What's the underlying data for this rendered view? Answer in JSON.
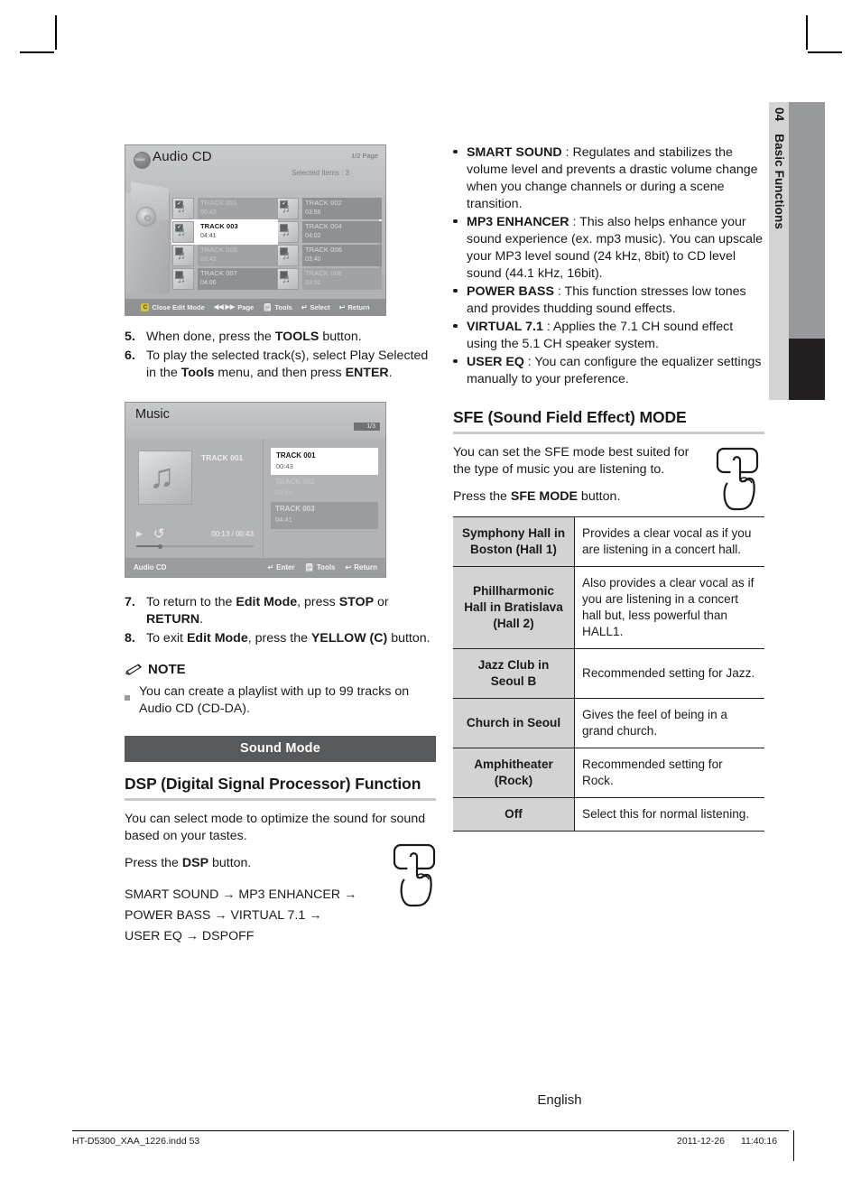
{
  "chapter_tab": {
    "number": "04",
    "title": "Basic Functions"
  },
  "audio_cd_screen": {
    "logo_label": "Music",
    "title": "Audio CD",
    "page_indicator": "1/2 Page",
    "selected_items": "Selected Items : 3",
    "tracks": [
      {
        "name": "TRACK 001",
        "time": "00:43",
        "checked": true,
        "state": "dim"
      },
      {
        "name": "TRACK 002",
        "time": "03:56",
        "checked": true,
        "state": "mid"
      },
      {
        "name": "TRACK 003",
        "time": "04:41",
        "checked": true,
        "state": "sel"
      },
      {
        "name": "TRACK 004",
        "time": "04:02",
        "checked": false,
        "state": "mid"
      },
      {
        "name": "TRACK 005",
        "time": "03:43",
        "checked": false,
        "state": "dim"
      },
      {
        "name": "TRACK 006",
        "time": "03:40",
        "checked": false,
        "state": "mid"
      },
      {
        "name": "TRACK 007",
        "time": "04:06",
        "checked": false,
        "state": "mid"
      },
      {
        "name": "TRACK 008",
        "time": "03:52",
        "checked": false,
        "state": "dim"
      }
    ],
    "footer": {
      "c_button": "C",
      "close_edit_mode": "Close Edit Mode",
      "page_arrows": "◀◀ ▶▶",
      "page": "Page",
      "tools": "Tools",
      "select": "Select",
      "return": "Return"
    }
  },
  "music_screen": {
    "title": "Music",
    "page_indicator": "1/3",
    "now_playing": "TRACK 001",
    "time": "00:13 / 00:43",
    "playlist": [
      {
        "name": "TRACK 001",
        "time": "00:43",
        "state": "sel"
      },
      {
        "name": "TRACK 002",
        "time": "03:56",
        "state": "dim"
      },
      {
        "name": "TRACK 003",
        "time": "04:41",
        "state": "mid"
      }
    ],
    "footer": {
      "source": "Audio CD",
      "enter": "Enter",
      "tools": "Tools",
      "return": "Return"
    }
  },
  "steps": [
    {
      "num": "5.",
      "html": "When done, press the <b>TOOLS</b> button."
    },
    {
      "num": "6.",
      "html": "To play the selected track(s), select Play Selected in the <b>Tools</b> menu, and then press <b>ENTER</b>."
    }
  ],
  "steps2": [
    {
      "num": "7.",
      "html": "To return to the <b>Edit Mode</b>, press <b>STOP</b> or <b>RETURN</b>."
    },
    {
      "num": "8.",
      "html": "To exit <b>Edit Mode</b>, press the <b>YELLOW (C)</b> button."
    }
  ],
  "note": {
    "title": "NOTE",
    "items": [
      "You can create a playlist with up to 99 tracks on Audio CD (CD-DA)."
    ]
  },
  "sound_mode": {
    "section_title": "Sound Mode",
    "dsp_heading": "DSP (Digital Signal Processor) Function",
    "dsp_intro": "You can select mode to optimize the sound for sound based on your tastes.",
    "dsp_press_html": "Press the <b>DSP</b> button.",
    "dsp_chain_lines": [
      "SMART SOUND → MP3 ENHANCER →",
      "POWER BASS →  VIRTUAL 7.1 →",
      "USER EQ → DSPOFF"
    ]
  },
  "dsp_modes": [
    {
      "html": "<b>SMART SOUND</b> : Regulates and stabilizes the volume level and prevents a drastic volume change when you change channels or during a scene transition."
    },
    {
      "html": "<b>MP3 ENHANCER</b> : This also helps enhance your sound experience (ex. mp3 music). You can upscale your MP3 level sound (24 kHz, 8bit) to CD level sound (44.1 kHz, 16bit)."
    },
    {
      "html": "<b>POWER BASS</b> : This function stresses low tones and provides thudding sound effects."
    },
    {
      "html": "<b>VIRTUAL 7.1</b> : Applies the 7.1 CH sound effect using the 5.1 CH speaker system."
    },
    {
      "html": "<b>USER EQ</b> : You can configure the equalizer settings manually to your preference."
    }
  ],
  "sfe": {
    "heading": "SFE (Sound Field Effect) MODE",
    "intro": "You can set the SFE mode best suited for the type of music you are listening to.",
    "press_html": "Press the <b>SFE MODE</b> button.",
    "rows": [
      {
        "label": "Symphony Hall in Boston (Hall 1)",
        "desc": "Provides a clear vocal as if you are listening in a concert hall."
      },
      {
        "label": "Phillharmonic Hall in Bratislava (Hall 2)",
        "desc": "Also provides a clear vocal as if you are listening in a concert hall but, less powerful than HALL1."
      },
      {
        "label": "Jazz Club in Seoul B",
        "desc": "Recommended setting for Jazz."
      },
      {
        "label": "Church in Seoul",
        "desc": "Gives the feel of being in a grand church."
      },
      {
        "label": "Amphitheater (Rock)",
        "desc": "Recommended setting for Rock."
      },
      {
        "label": "Off",
        "desc": "Select this for normal listening."
      }
    ]
  },
  "page_footer": {
    "language": "English",
    "file_name": "HT-D5300_XAA_1226.indd   53",
    "date": "2011-12-26",
    "time": "11:40:16"
  }
}
